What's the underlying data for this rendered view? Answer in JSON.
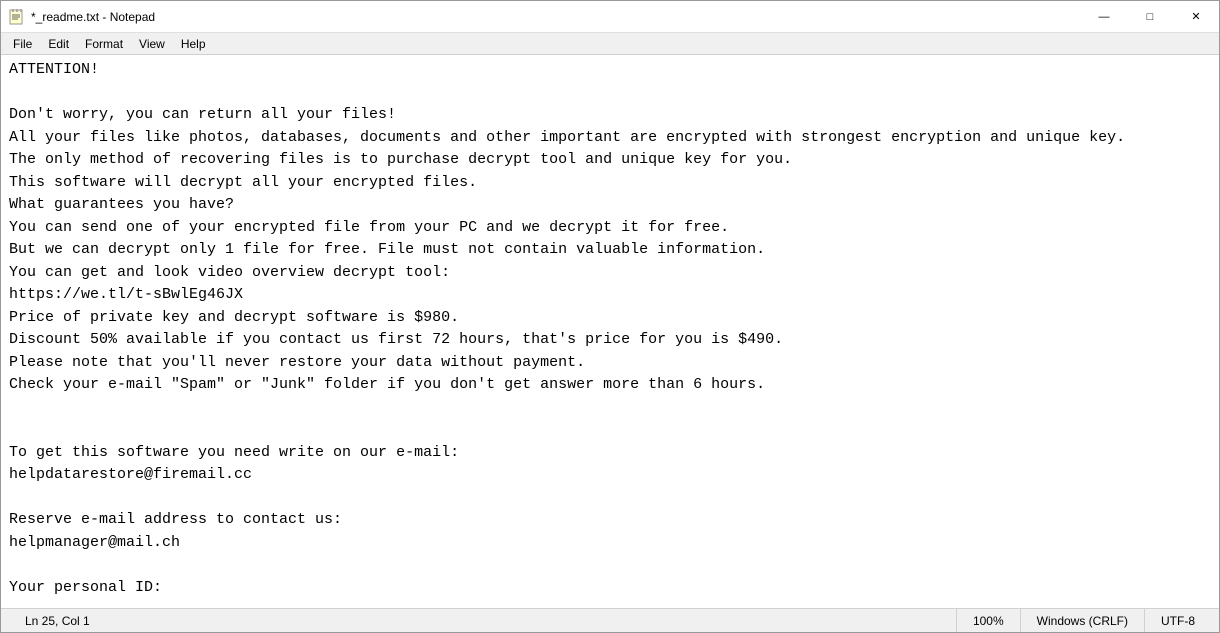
{
  "window": {
    "title": "*_readme.txt - Notepad",
    "icon": "notepad"
  },
  "title_controls": {
    "minimize": "—",
    "maximize": "□",
    "close": "✕"
  },
  "menu": {
    "items": [
      "File",
      "Edit",
      "Format",
      "View",
      "Help"
    ]
  },
  "content": "ATTENTION!\n\nDon't worry, you can return all your files!\nAll your files like photos, databases, documents and other important are encrypted with strongest encryption and unique key.\nThe only method of recovering files is to purchase decrypt tool and unique key for you.\nThis software will decrypt all your encrypted files.\nWhat guarantees you have?\nYou can send one of your encrypted file from your PC and we decrypt it for free.\nBut we can decrypt only 1 file for free. File must not contain valuable information.\nYou can get and look video overview decrypt tool:\nhttps://we.tl/t-sBwlEg46JX\nPrice of private key and decrypt software is $980.\nDiscount 50% available if you contact us first 72 hours, that's price for you is $490.\nPlease note that you'll never restore your data without payment.\nCheck your e-mail \"Spam\" or \"Junk\" folder if you don't get answer more than 6 hours.\n\n\nTo get this software you need write on our e-mail:\nhelpdatarestore@firemail.cc\n\nReserve e-mail address to contact us:\nhelpmanager@mail.ch\n\nYour personal ID:",
  "status": {
    "position": "Ln 25, Col 1",
    "zoom": "100%",
    "line_ending": "Windows (CRLF)",
    "encoding": "UTF-8"
  }
}
